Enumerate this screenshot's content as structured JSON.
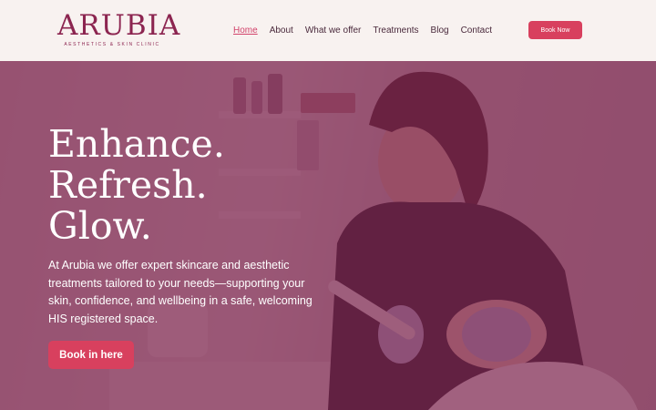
{
  "header": {
    "logo_text": "ARUBIA",
    "logo_subtitle": "AESTHETICS & SKIN CLINIC",
    "nav": [
      {
        "label": "Home",
        "active": true
      },
      {
        "label": "About",
        "active": false
      },
      {
        "label": "What we offer",
        "active": false
      },
      {
        "label": "Treatments",
        "active": false
      },
      {
        "label": "Blog",
        "active": false
      },
      {
        "label": "Contact",
        "active": false
      }
    ],
    "book_now_label": "Book Now"
  },
  "hero": {
    "title_lines": [
      "Enhance.",
      "Refresh.",
      "Glow."
    ],
    "body": "At Arubia  we offer expert skincare and aesthetic treatments tailored to your needs—supporting your skin, confidence, and wellbeing in a safe, welcoming HIS registered space.",
    "cta_label": "Book in here",
    "image_description": "practitioner-performing-facial-treatment-photo"
  },
  "colors": {
    "brand": "#8c2550",
    "accent": "#d8405e",
    "nav_active": "#d2436b",
    "overlay": "#7d244e",
    "header_bg": "#f8f2f0"
  }
}
